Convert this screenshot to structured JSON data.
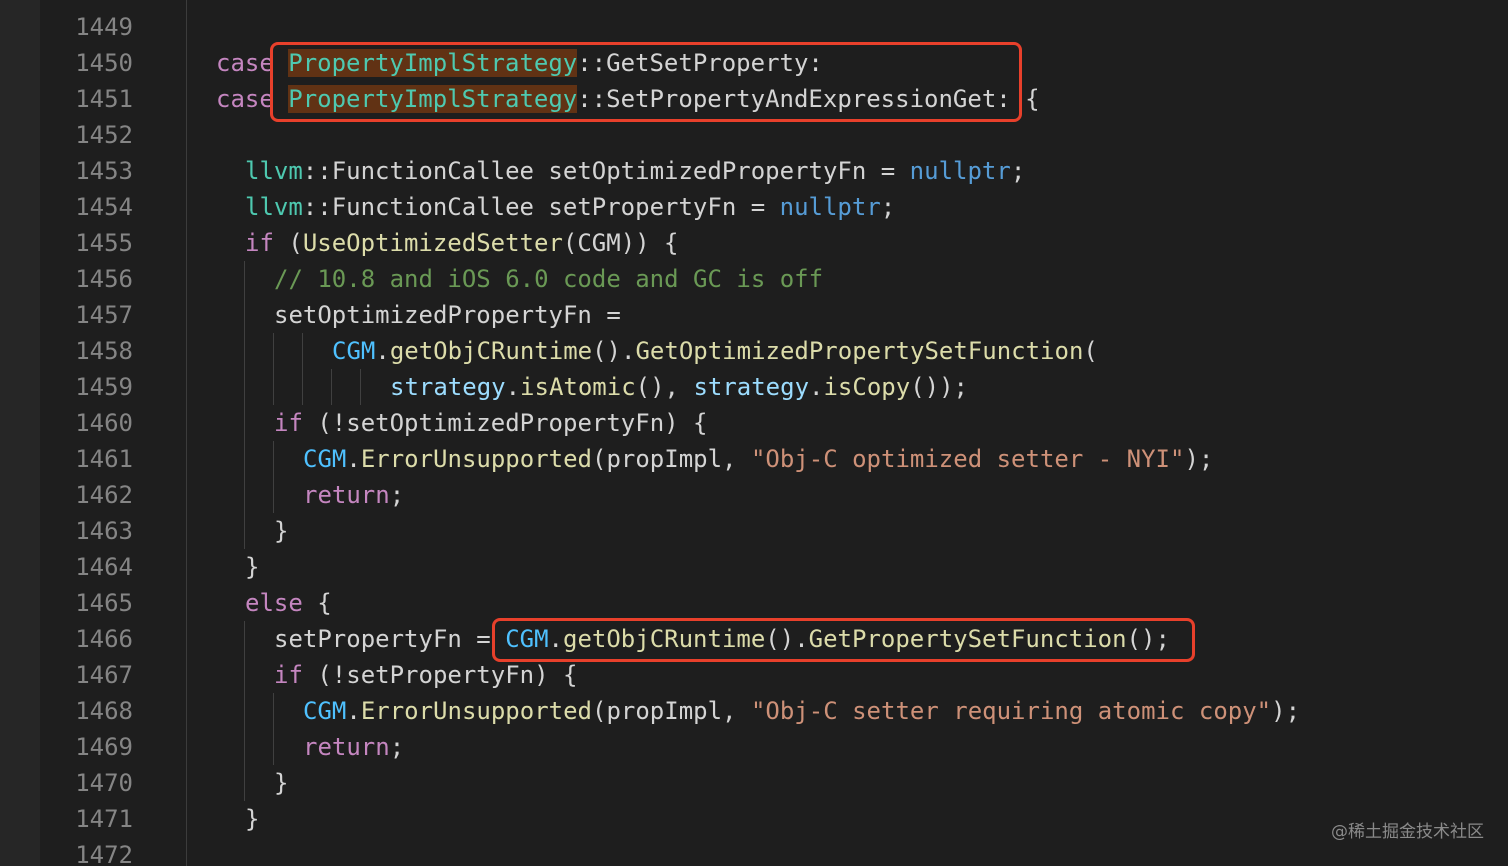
{
  "editor": {
    "language": "C++",
    "lines": [
      {
        "number": "1449",
        "indent": 0,
        "tokens": []
      },
      {
        "number": "1450",
        "indent": 0,
        "tokens": [
          {
            "text": "case",
            "type": "kw"
          },
          {
            "text": " ",
            "type": "punc"
          },
          {
            "text": "PropertyImplStrategy",
            "type": "type",
            "highlight": true
          },
          {
            "text": "::GetSetProperty:",
            "type": "punc"
          }
        ]
      },
      {
        "number": "1451",
        "indent": 0,
        "tokens": [
          {
            "text": "case",
            "type": "kw"
          },
          {
            "text": " ",
            "type": "punc"
          },
          {
            "text": "PropertyImplStrategy",
            "type": "type",
            "highlight": true
          },
          {
            "text": "::SetPropertyAndExpressionGet: {",
            "type": "punc"
          }
        ]
      },
      {
        "number": "1452",
        "indent": 0,
        "tokens": []
      },
      {
        "number": "1453",
        "indent": 1,
        "tokens": [
          {
            "text": "llvm",
            "type": "ns"
          },
          {
            "text": "::FunctionCallee setOptimizedPropertyFn = ",
            "type": "punc"
          },
          {
            "text": "nullptr",
            "type": "lit"
          },
          {
            "text": ";",
            "type": "punc"
          }
        ]
      },
      {
        "number": "1454",
        "indent": 1,
        "tokens": [
          {
            "text": "llvm",
            "type": "ns"
          },
          {
            "text": "::FunctionCallee setPropertyFn = ",
            "type": "punc"
          },
          {
            "text": "nullptr",
            "type": "lit"
          },
          {
            "text": ";",
            "type": "punc"
          }
        ]
      },
      {
        "number": "1455",
        "indent": 1,
        "tokens": [
          {
            "text": "if",
            "type": "kw"
          },
          {
            "text": " (",
            "type": "punc"
          },
          {
            "text": "UseOptimizedSetter",
            "type": "fn"
          },
          {
            "text": "(CGM)) {",
            "type": "punc"
          }
        ]
      },
      {
        "number": "1456",
        "indent": 2,
        "tokens": [
          {
            "text": "// 10.8 and iOS 6.0 code and GC is off",
            "type": "com"
          }
        ]
      },
      {
        "number": "1457",
        "indent": 2,
        "tokens": [
          {
            "text": "setOptimizedPropertyFn =",
            "type": "punc"
          }
        ]
      },
      {
        "number": "1458",
        "indent": 4,
        "tokens": [
          {
            "text": "CGM",
            "type": "con"
          },
          {
            "text": ".",
            "type": "punc"
          },
          {
            "text": "getObjCRuntime",
            "type": "fn"
          },
          {
            "text": "().",
            "type": "punc"
          },
          {
            "text": "GetOptimizedPropertySetFunction",
            "type": "fn"
          },
          {
            "text": "(",
            "type": "punc"
          }
        ]
      },
      {
        "number": "1459",
        "indent": 6,
        "tokens": [
          {
            "text": "strategy",
            "type": "var"
          },
          {
            "text": ".",
            "type": "punc"
          },
          {
            "text": "isAtomic",
            "type": "fn"
          },
          {
            "text": "(), ",
            "type": "punc"
          },
          {
            "text": "strategy",
            "type": "var"
          },
          {
            "text": ".",
            "type": "punc"
          },
          {
            "text": "isCopy",
            "type": "fn"
          },
          {
            "text": "());",
            "type": "punc"
          }
        ]
      },
      {
        "number": "1460",
        "indent": 2,
        "tokens": [
          {
            "text": "if",
            "type": "kw"
          },
          {
            "text": " (!setOptimizedPropertyFn) {",
            "type": "punc"
          }
        ]
      },
      {
        "number": "1461",
        "indent": 3,
        "tokens": [
          {
            "text": "CGM",
            "type": "con"
          },
          {
            "text": ".",
            "type": "punc"
          },
          {
            "text": "ErrorUnsupported",
            "type": "fn"
          },
          {
            "text": "(propImpl, ",
            "type": "punc"
          },
          {
            "text": "\"Obj-C optimized setter - NYI\"",
            "type": "str"
          },
          {
            "text": ");",
            "type": "punc"
          }
        ]
      },
      {
        "number": "1462",
        "indent": 3,
        "tokens": [
          {
            "text": "return",
            "type": "kw"
          },
          {
            "text": ";",
            "type": "punc"
          }
        ]
      },
      {
        "number": "1463",
        "indent": 2,
        "tokens": [
          {
            "text": "}",
            "type": "punc"
          }
        ]
      },
      {
        "number": "1464",
        "indent": 1,
        "tokens": [
          {
            "text": "}",
            "type": "punc"
          }
        ]
      },
      {
        "number": "1465",
        "indent": 1,
        "tokens": [
          {
            "text": "else",
            "type": "kw"
          },
          {
            "text": " {",
            "type": "punc"
          }
        ]
      },
      {
        "number": "1466",
        "indent": 2,
        "tokens": [
          {
            "text": "setPropertyFn = ",
            "type": "punc"
          },
          {
            "text": "CGM",
            "type": "con"
          },
          {
            "text": ".",
            "type": "punc"
          },
          {
            "text": "getObjCRuntime",
            "type": "fn"
          },
          {
            "text": "().",
            "type": "punc"
          },
          {
            "text": "GetPropertySetFunction",
            "type": "fn"
          },
          {
            "text": "();",
            "type": "punc"
          }
        ]
      },
      {
        "number": "1467",
        "indent": 2,
        "tokens": [
          {
            "text": "if",
            "type": "kw"
          },
          {
            "text": " (!setPropertyFn) {",
            "type": "punc"
          }
        ]
      },
      {
        "number": "1468",
        "indent": 3,
        "tokens": [
          {
            "text": "CGM",
            "type": "con"
          },
          {
            "text": ".",
            "type": "punc"
          },
          {
            "text": "ErrorUnsupported",
            "type": "fn"
          },
          {
            "text": "(propImpl, ",
            "type": "punc"
          },
          {
            "text": "\"Obj-C setter requiring atomic copy\"",
            "type": "str"
          },
          {
            "text": ");",
            "type": "punc"
          }
        ]
      },
      {
        "number": "1469",
        "indent": 3,
        "tokens": [
          {
            "text": "return",
            "type": "kw"
          },
          {
            "text": ";",
            "type": "punc"
          }
        ]
      },
      {
        "number": "1470",
        "indent": 2,
        "tokens": [
          {
            "text": "}",
            "type": "punc"
          }
        ]
      },
      {
        "number": "1471",
        "indent": 1,
        "tokens": [
          {
            "text": "}",
            "type": "punc"
          }
        ]
      },
      {
        "number": "1472",
        "indent": 0,
        "tokens": []
      }
    ]
  },
  "annotations": {
    "box_color": "#e8402b",
    "boxes": [
      {
        "first_line": "1450",
        "last_line": "1451",
        "label": "case-labels-highlight"
      },
      {
        "first_line": "1466",
        "last_line": "1466",
        "label": "get-property-set-function-highlight"
      }
    ]
  },
  "colors": {
    "background": "#1e1e1e",
    "keyword": "#c586c0",
    "type": "#4ec9b0",
    "function": "#dcdcaa",
    "variable": "#9cdcfe",
    "constant": "#4fc1ff",
    "literal": "#569cd6",
    "string": "#ce9178",
    "comment": "#6a9955",
    "line_number": "#858585",
    "match_highlight": "#613214"
  },
  "watermark": {
    "text": "@稀土掘金技术社区"
  }
}
